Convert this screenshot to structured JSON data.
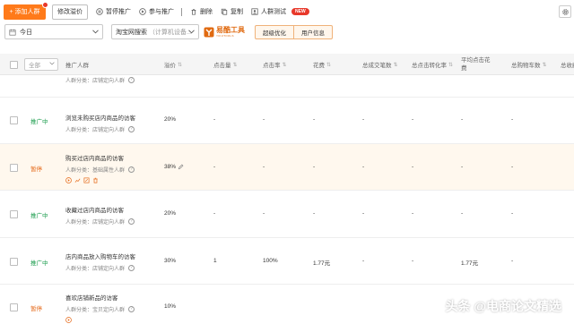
{
  "toolbar": {
    "add_label": "+ 添加人群",
    "edit_label": "修改溢价",
    "pause_label": "暂停推广",
    "join_label": "参与推广",
    "delete_label": "删除",
    "copy_label": "复制",
    "test_label": "人群测试",
    "new_badge": "NEW"
  },
  "filters": {
    "date_value": "今日",
    "scene_value": "淘宝网搜索",
    "scene_hint": "（计算机设备...",
    "logo_text": "易酷工具",
    "logo_sub": "YIKUTOOLS",
    "pill_1": "超级优化",
    "pill_2": "用户信息"
  },
  "table": {
    "all_select": "全部",
    "headers": {
      "audience": "推广人群",
      "premium": "溢价",
      "impressions": "点击量",
      "ctr": "点击率",
      "spend": "花费",
      "total_deals": "总成交笔数",
      "conversion": "总点击转化率",
      "avg_cpc": "平均点击花",
      "avg_cpc_2": "费",
      "cart": "总购物车数",
      "fav": "总收藏"
    },
    "partial_row_cat": "人群分类：店铺定向人群",
    "rows": [
      {
        "status": "推广中",
        "name": "浏览未购买店内商品的访客",
        "cat": "人群分类：店铺定向人群",
        "premium": "20%",
        "clicks": "-",
        "ctr": "-",
        "spend": "-",
        "deals": "-",
        "conv": "-",
        "cpc": "-",
        "cart": "-"
      },
      {
        "status": "暂停",
        "name": "购买过店内商品的访客",
        "cat": "人群分类：基础属性人群",
        "premium": "38%",
        "clicks": "-",
        "ctr": "-",
        "spend": "-",
        "deals": "-",
        "conv": "-",
        "cpc": "-",
        "cart": "-"
      },
      {
        "status": "推广中",
        "name": "收藏过店内商品的访客",
        "cat": "人群分类：店铺定向人群",
        "premium": "20%",
        "clicks": "-",
        "ctr": "-",
        "spend": "-",
        "deals": "-",
        "conv": "-",
        "cpc": "-",
        "cart": "-"
      },
      {
        "status": "推广中",
        "name": "店内商品放入购物车的访客",
        "cat": "人群分类：店铺定向人群",
        "premium": "30%",
        "clicks": "1",
        "ctr": "100%",
        "spend": "1.77元",
        "deals": "-",
        "conv": "-",
        "cpc": "1.77元",
        "cart": "-"
      },
      {
        "status": "暂停",
        "name": "喜欢店铺新品的访客",
        "cat": "人群分类：宝贝定向人群",
        "premium": "10%"
      }
    ]
  },
  "watermark": "头条 @电商论文精选",
  "colors": {
    "accent": "#ff7a1a",
    "active": "#1a9c4c",
    "paused": "#e56a1a",
    "new_badge": "#e8382a"
  }
}
